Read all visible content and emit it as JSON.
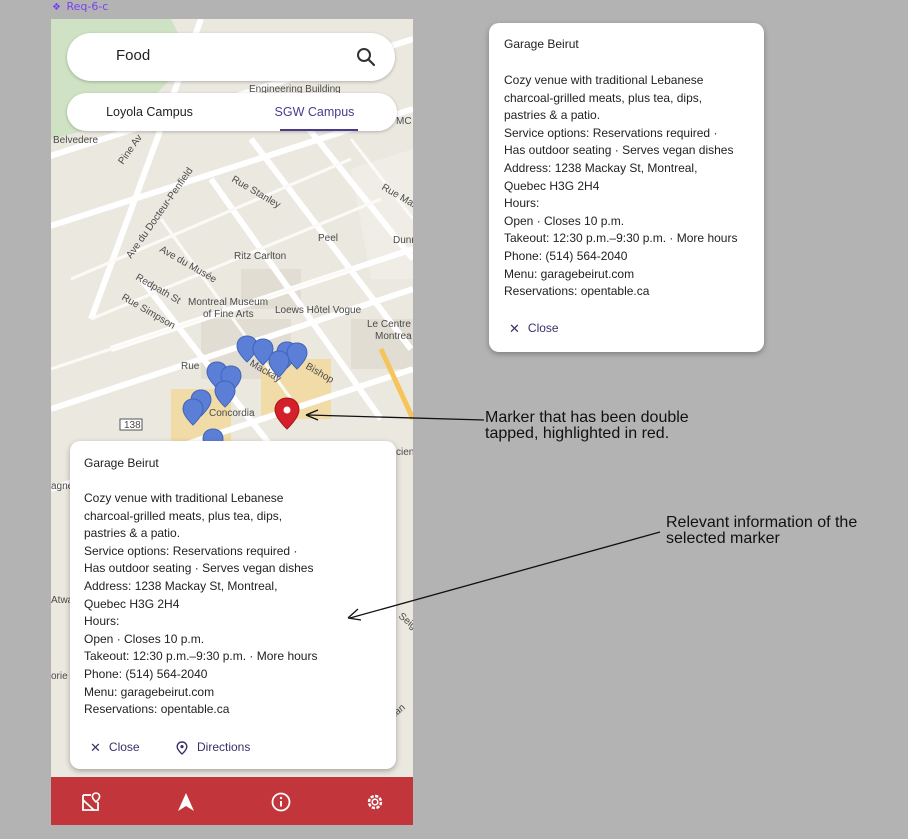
{
  "frame_label": "Req-6-c",
  "search": {
    "value": "Food"
  },
  "campus_tabs": [
    {
      "label": "Loyola Campus",
      "selected": false
    },
    {
      "label": "SGW Campus",
      "selected": true
    }
  ],
  "map": {
    "labels": {
      "belvedere": "Belvedere",
      "engineering": "Engineering Building",
      "mc": "MC",
      "pine": "Pine Av",
      "docteur": "Ave du Docteur-Penfield",
      "stanley": "Rue Stanley",
      "rue_mar": "Rue Mar",
      "peel": "Peel",
      "dunn": "Dunn",
      "musee": "Ave du Musée",
      "ritz": "Ritz Carlton",
      "redpath": "Redpath St",
      "simpson": "Rue Simpson",
      "museum": "Montreal Museum\nof Fine Arts",
      "loews": "Loews Hôtel Vogue",
      "centre": "Le Centre\nMontrea",
      "bishop": "Bishop",
      "mackay": "Mackay",
      "concordia": "Concordia",
      "route": "138",
      "atwa": "Atwa",
      "agne": "agne",
      "orie": "orie",
      "seig": "Seig",
      "nan": "nan",
      "cien": "cien",
      "rue_left": "Rue"
    }
  },
  "info_card_large": {
    "title": "Garage Beirut",
    "lines": [
      "Cozy venue with traditional Lebanese",
      "charcoal-grilled meats, plus tea, dips,",
      "pastries & a patio.",
      "Service options: Reservations required ·",
      "Has outdoor seating · Serves vegan dishes",
      "Address: 1238 Mackay St, Montreal,",
      "Quebec H3G 2H4",
      "Hours:",
      "Open · Closes 10 p.m.",
      "Takeout: 12:30 p.m.–9:30 p.m. · More hours",
      "Phone: (514) 564-2040",
      "Menu: garagebeirut.com",
      "Reservations: opentable.ca"
    ],
    "close_label": "Close",
    "directions_label": "Directions"
  },
  "info_card_small": {
    "title": "Garage Beirut",
    "lines": [
      "Cozy venue with traditional Lebanese",
      "charcoal-grilled meats, plus tea, dips,",
      "pastries & a patio.",
      "Service options: Reservations required ·",
      "Has outdoor seating · Serves vegan dishes",
      "Address: 1238 Mackay St, Montreal,",
      "Quebec H3G 2H4",
      "Hours:",
      "Open · Closes 10 p.m.",
      "Takeout: 12:30 p.m.–9:30 p.m. · More hours",
      "Phone: (514) 564-2040",
      "Menu: garagebeirut.com",
      "Reservations: opentable.ca"
    ],
    "close_label": "Close"
  },
  "annotations": {
    "marker_note": [
      "Marker that has been double",
      "tapped, highlighted in red."
    ],
    "info_note": [
      "Relevant information of the",
      "selected marker"
    ]
  },
  "bottom_nav": [
    "map-icon",
    "navigation-arrow-icon",
    "info-icon",
    "settings-icon"
  ],
  "colors": {
    "accent": "#4a3a8c",
    "nav_bar": "#c1353b",
    "marker_blue": "#5b7fd6",
    "marker_selected": "#d4202a"
  }
}
